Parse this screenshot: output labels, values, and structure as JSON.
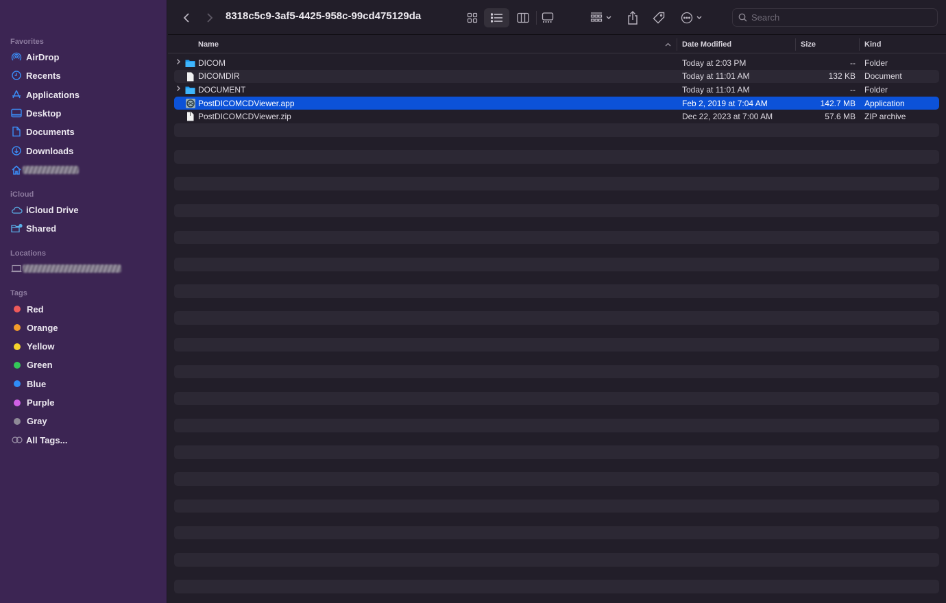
{
  "sidebar": {
    "favorites_title": "Favorites",
    "favorites": [
      {
        "label": "AirDrop",
        "icon": "airdrop-icon"
      },
      {
        "label": "Recents",
        "icon": "clock-icon"
      },
      {
        "label": "Applications",
        "icon": "applications-icon"
      },
      {
        "label": "Desktop",
        "icon": "desktop-icon"
      },
      {
        "label": "Documents",
        "icon": "document-icon"
      },
      {
        "label": "Downloads",
        "icon": "download-icon"
      }
    ],
    "icloud_title": "iCloud",
    "icloud": [
      {
        "label": "iCloud Drive",
        "icon": "cloud-icon"
      },
      {
        "label": "Shared",
        "icon": "shared-folder-icon"
      }
    ],
    "locations_title": "Locations",
    "tags_title": "Tags",
    "tags": [
      {
        "label": "Red",
        "color": "#ef5a5a"
      },
      {
        "label": "Orange",
        "color": "#f39c2b"
      },
      {
        "label": "Yellow",
        "color": "#f6d22c"
      },
      {
        "label": "Green",
        "color": "#34c759"
      },
      {
        "label": "Blue",
        "color": "#2f8cf7"
      },
      {
        "label": "Purple",
        "color": "#d060e6"
      },
      {
        "label": "Gray",
        "color": "#8e8a96"
      }
    ],
    "all_tags": "All Tags..."
  },
  "toolbar": {
    "title": "8318c5c9-3af5-4425-958c-99cd475129da",
    "search_placeholder": "Search"
  },
  "columns": {
    "name": "Name",
    "date": "Date Modified",
    "size": "Size",
    "kind": "Kind"
  },
  "files": [
    {
      "name": "DICOM",
      "date": "Today at 2:03 PM",
      "size": "--",
      "kind": "Folder",
      "type": "folder",
      "selected": false
    },
    {
      "name": "DICOMDIR",
      "date": "Today at 11:01 AM",
      "size": "132 KB",
      "kind": "Document",
      "type": "file",
      "selected": false
    },
    {
      "name": "DOCUMENT",
      "date": "Today at 11:01 AM",
      "size": "--",
      "kind": "Folder",
      "type": "folder",
      "selected": false
    },
    {
      "name": "PostDICOMCDViewer.app",
      "date": "Feb 2, 2019 at 7:04 AM",
      "size": "142.7 MB",
      "kind": "Application",
      "type": "app",
      "selected": true
    },
    {
      "name": "PostDICOMCDViewer.zip",
      "date": "Dec 22, 2023 at 7:00 AM",
      "size": "57.6 MB",
      "kind": "ZIP archive",
      "type": "zip",
      "selected": false
    }
  ],
  "colors": {
    "selection": "#0c52d8",
    "sidebar_bg": "#3c2553",
    "accent": "#3b8cf5"
  }
}
